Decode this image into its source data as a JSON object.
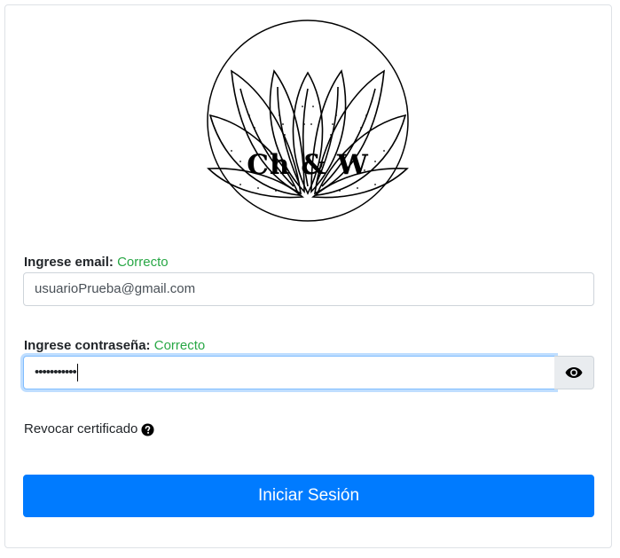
{
  "logo": {
    "text": "Ch & W",
    "icon": "lotus-logo"
  },
  "email": {
    "label": "Ingrese email:",
    "status": "Correcto",
    "value": "usuarioPrueba@gmail.com"
  },
  "password": {
    "label": "Ingrese contraseña:",
    "status": "Correcto",
    "masked_value": "•••••••••••",
    "toggle_icon": "eye-icon"
  },
  "revoke": {
    "label": "Revocar certificado",
    "icon": "question-circle-icon"
  },
  "submit": {
    "label": "Iniciar Sesión"
  },
  "colors": {
    "success": "#28a745",
    "primary": "#007bff",
    "focus_border": "#80bdff"
  }
}
